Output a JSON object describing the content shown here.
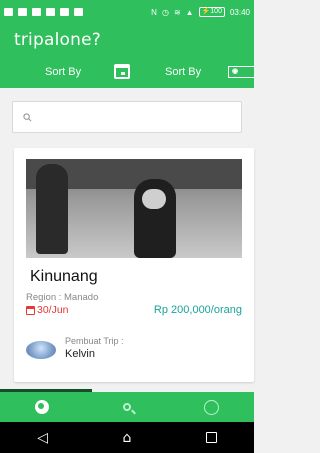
{
  "status_bar": {
    "battery": "100",
    "time": "03:40"
  },
  "app": {
    "title": "tripalone?"
  },
  "sort_bar": {
    "sort_date_label": "Sort By",
    "sort_price_label": "Sort By",
    "icons": [
      "calendar-icon",
      "money-icon"
    ]
  },
  "search": {
    "placeholder": ""
  },
  "trip": {
    "title": "Kinunang",
    "region": "Region : Manado",
    "date": "30/Jun",
    "price": "Rp 200,000/orang",
    "creator_label": "Pembuat Trip :",
    "creator_name": "Kelvin"
  },
  "bottom_nav": {
    "tabs": [
      "globe-icon",
      "search-icon",
      "smiley-icon"
    ],
    "active_index": 0
  },
  "colors": {
    "primary": "#2fbf5d",
    "date_red": "#e53935",
    "price_teal": "#1aa39a"
  }
}
